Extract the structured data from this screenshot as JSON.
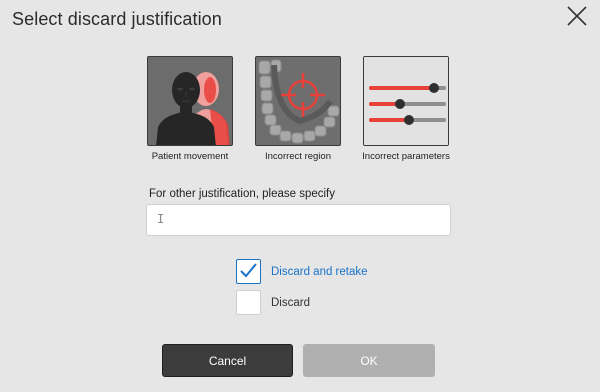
{
  "dialog": {
    "title": "Select discard justification",
    "close_icon": "close-icon"
  },
  "justifications": [
    {
      "label": "Patient movement",
      "icon": "patient-movement-icon"
    },
    {
      "label": "Incorrect region",
      "icon": "incorrect-region-icon"
    },
    {
      "label": "Incorrect parameters",
      "icon": "incorrect-parameters-icon"
    }
  ],
  "other": {
    "label": "For other justification, please specify",
    "value": "",
    "placeholder": ""
  },
  "options": [
    {
      "label": "Discard and retake",
      "checked": true,
      "color": "#1a73c8"
    },
    {
      "label": "Discard",
      "checked": false,
      "color": "#333333"
    }
  ],
  "buttons": {
    "cancel": "Cancel",
    "ok": "OK"
  },
  "colors": {
    "accent": "#1a73c8",
    "highlight_red": "#e8403a",
    "cancel_bg": "#3c3c3c",
    "ok_disabled_bg": "#b0b0b0"
  }
}
